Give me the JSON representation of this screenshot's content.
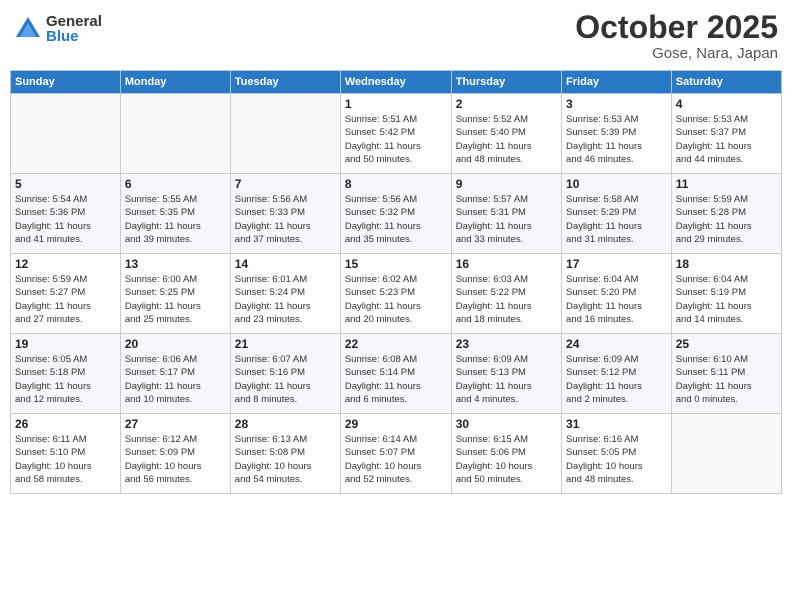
{
  "logo": {
    "general": "General",
    "blue": "Blue"
  },
  "title": "October 2025",
  "location": "Gose, Nara, Japan",
  "days_of_week": [
    "Sunday",
    "Monday",
    "Tuesday",
    "Wednesday",
    "Thursday",
    "Friday",
    "Saturday"
  ],
  "weeks": [
    [
      {
        "day": "",
        "info": ""
      },
      {
        "day": "",
        "info": ""
      },
      {
        "day": "",
        "info": ""
      },
      {
        "day": "1",
        "info": "Sunrise: 5:51 AM\nSunset: 5:42 PM\nDaylight: 11 hours\nand 50 minutes."
      },
      {
        "day": "2",
        "info": "Sunrise: 5:52 AM\nSunset: 5:40 PM\nDaylight: 11 hours\nand 48 minutes."
      },
      {
        "day": "3",
        "info": "Sunrise: 5:53 AM\nSunset: 5:39 PM\nDaylight: 11 hours\nand 46 minutes."
      },
      {
        "day": "4",
        "info": "Sunrise: 5:53 AM\nSunset: 5:37 PM\nDaylight: 11 hours\nand 44 minutes."
      }
    ],
    [
      {
        "day": "5",
        "info": "Sunrise: 5:54 AM\nSunset: 5:36 PM\nDaylight: 11 hours\nand 41 minutes."
      },
      {
        "day": "6",
        "info": "Sunrise: 5:55 AM\nSunset: 5:35 PM\nDaylight: 11 hours\nand 39 minutes."
      },
      {
        "day": "7",
        "info": "Sunrise: 5:56 AM\nSunset: 5:33 PM\nDaylight: 11 hours\nand 37 minutes."
      },
      {
        "day": "8",
        "info": "Sunrise: 5:56 AM\nSunset: 5:32 PM\nDaylight: 11 hours\nand 35 minutes."
      },
      {
        "day": "9",
        "info": "Sunrise: 5:57 AM\nSunset: 5:31 PM\nDaylight: 11 hours\nand 33 minutes."
      },
      {
        "day": "10",
        "info": "Sunrise: 5:58 AM\nSunset: 5:29 PM\nDaylight: 11 hours\nand 31 minutes."
      },
      {
        "day": "11",
        "info": "Sunrise: 5:59 AM\nSunset: 5:28 PM\nDaylight: 11 hours\nand 29 minutes."
      }
    ],
    [
      {
        "day": "12",
        "info": "Sunrise: 5:59 AM\nSunset: 5:27 PM\nDaylight: 11 hours\nand 27 minutes."
      },
      {
        "day": "13",
        "info": "Sunrise: 6:00 AM\nSunset: 5:25 PM\nDaylight: 11 hours\nand 25 minutes."
      },
      {
        "day": "14",
        "info": "Sunrise: 6:01 AM\nSunset: 5:24 PM\nDaylight: 11 hours\nand 23 minutes."
      },
      {
        "day": "15",
        "info": "Sunrise: 6:02 AM\nSunset: 5:23 PM\nDaylight: 11 hours\nand 20 minutes."
      },
      {
        "day": "16",
        "info": "Sunrise: 6:03 AM\nSunset: 5:22 PM\nDaylight: 11 hours\nand 18 minutes."
      },
      {
        "day": "17",
        "info": "Sunrise: 6:04 AM\nSunset: 5:20 PM\nDaylight: 11 hours\nand 16 minutes."
      },
      {
        "day": "18",
        "info": "Sunrise: 6:04 AM\nSunset: 5:19 PM\nDaylight: 11 hours\nand 14 minutes."
      }
    ],
    [
      {
        "day": "19",
        "info": "Sunrise: 6:05 AM\nSunset: 5:18 PM\nDaylight: 11 hours\nand 12 minutes."
      },
      {
        "day": "20",
        "info": "Sunrise: 6:06 AM\nSunset: 5:17 PM\nDaylight: 11 hours\nand 10 minutes."
      },
      {
        "day": "21",
        "info": "Sunrise: 6:07 AM\nSunset: 5:16 PM\nDaylight: 11 hours\nand 8 minutes."
      },
      {
        "day": "22",
        "info": "Sunrise: 6:08 AM\nSunset: 5:14 PM\nDaylight: 11 hours\nand 6 minutes."
      },
      {
        "day": "23",
        "info": "Sunrise: 6:09 AM\nSunset: 5:13 PM\nDaylight: 11 hours\nand 4 minutes."
      },
      {
        "day": "24",
        "info": "Sunrise: 6:09 AM\nSunset: 5:12 PM\nDaylight: 11 hours\nand 2 minutes."
      },
      {
        "day": "25",
        "info": "Sunrise: 6:10 AM\nSunset: 5:11 PM\nDaylight: 11 hours\nand 0 minutes."
      }
    ],
    [
      {
        "day": "26",
        "info": "Sunrise: 6:11 AM\nSunset: 5:10 PM\nDaylight: 10 hours\nand 58 minutes."
      },
      {
        "day": "27",
        "info": "Sunrise: 6:12 AM\nSunset: 5:09 PM\nDaylight: 10 hours\nand 56 minutes."
      },
      {
        "day": "28",
        "info": "Sunrise: 6:13 AM\nSunset: 5:08 PM\nDaylight: 10 hours\nand 54 minutes."
      },
      {
        "day": "29",
        "info": "Sunrise: 6:14 AM\nSunset: 5:07 PM\nDaylight: 10 hours\nand 52 minutes."
      },
      {
        "day": "30",
        "info": "Sunrise: 6:15 AM\nSunset: 5:06 PM\nDaylight: 10 hours\nand 50 minutes."
      },
      {
        "day": "31",
        "info": "Sunrise: 6:16 AM\nSunset: 5:05 PM\nDaylight: 10 hours\nand 48 minutes."
      },
      {
        "day": "",
        "info": ""
      }
    ]
  ]
}
